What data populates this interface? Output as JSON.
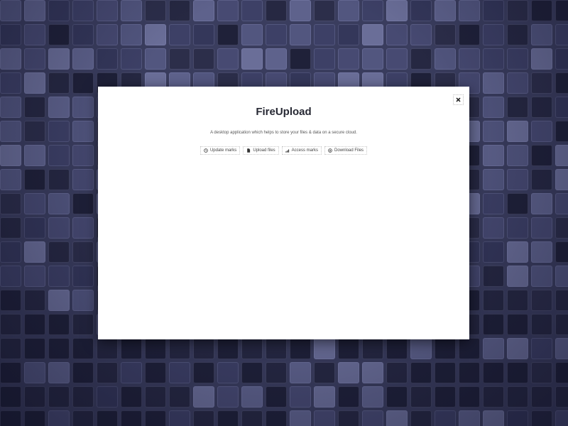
{
  "background": {
    "colors": [
      "#2c2e4a",
      "#34375a",
      "#3d4066",
      "#474a72",
      "#52567f",
      "#5e628c",
      "#6a6e98",
      "#262842",
      "#1f2139"
    ]
  },
  "dialog": {
    "title": "FireUpload",
    "description": "A desktop application which helps to store your files & data on a secure cloud.",
    "close_icon": "close-icon",
    "actions": [
      {
        "label": "Update marks",
        "icon": "refresh-icon"
      },
      {
        "label": "Upload files",
        "icon": "file-icon"
      },
      {
        "label": "Access marks",
        "icon": "signal-bars-icon"
      },
      {
        "label": "Download Files",
        "icon": "download-icon"
      }
    ]
  }
}
